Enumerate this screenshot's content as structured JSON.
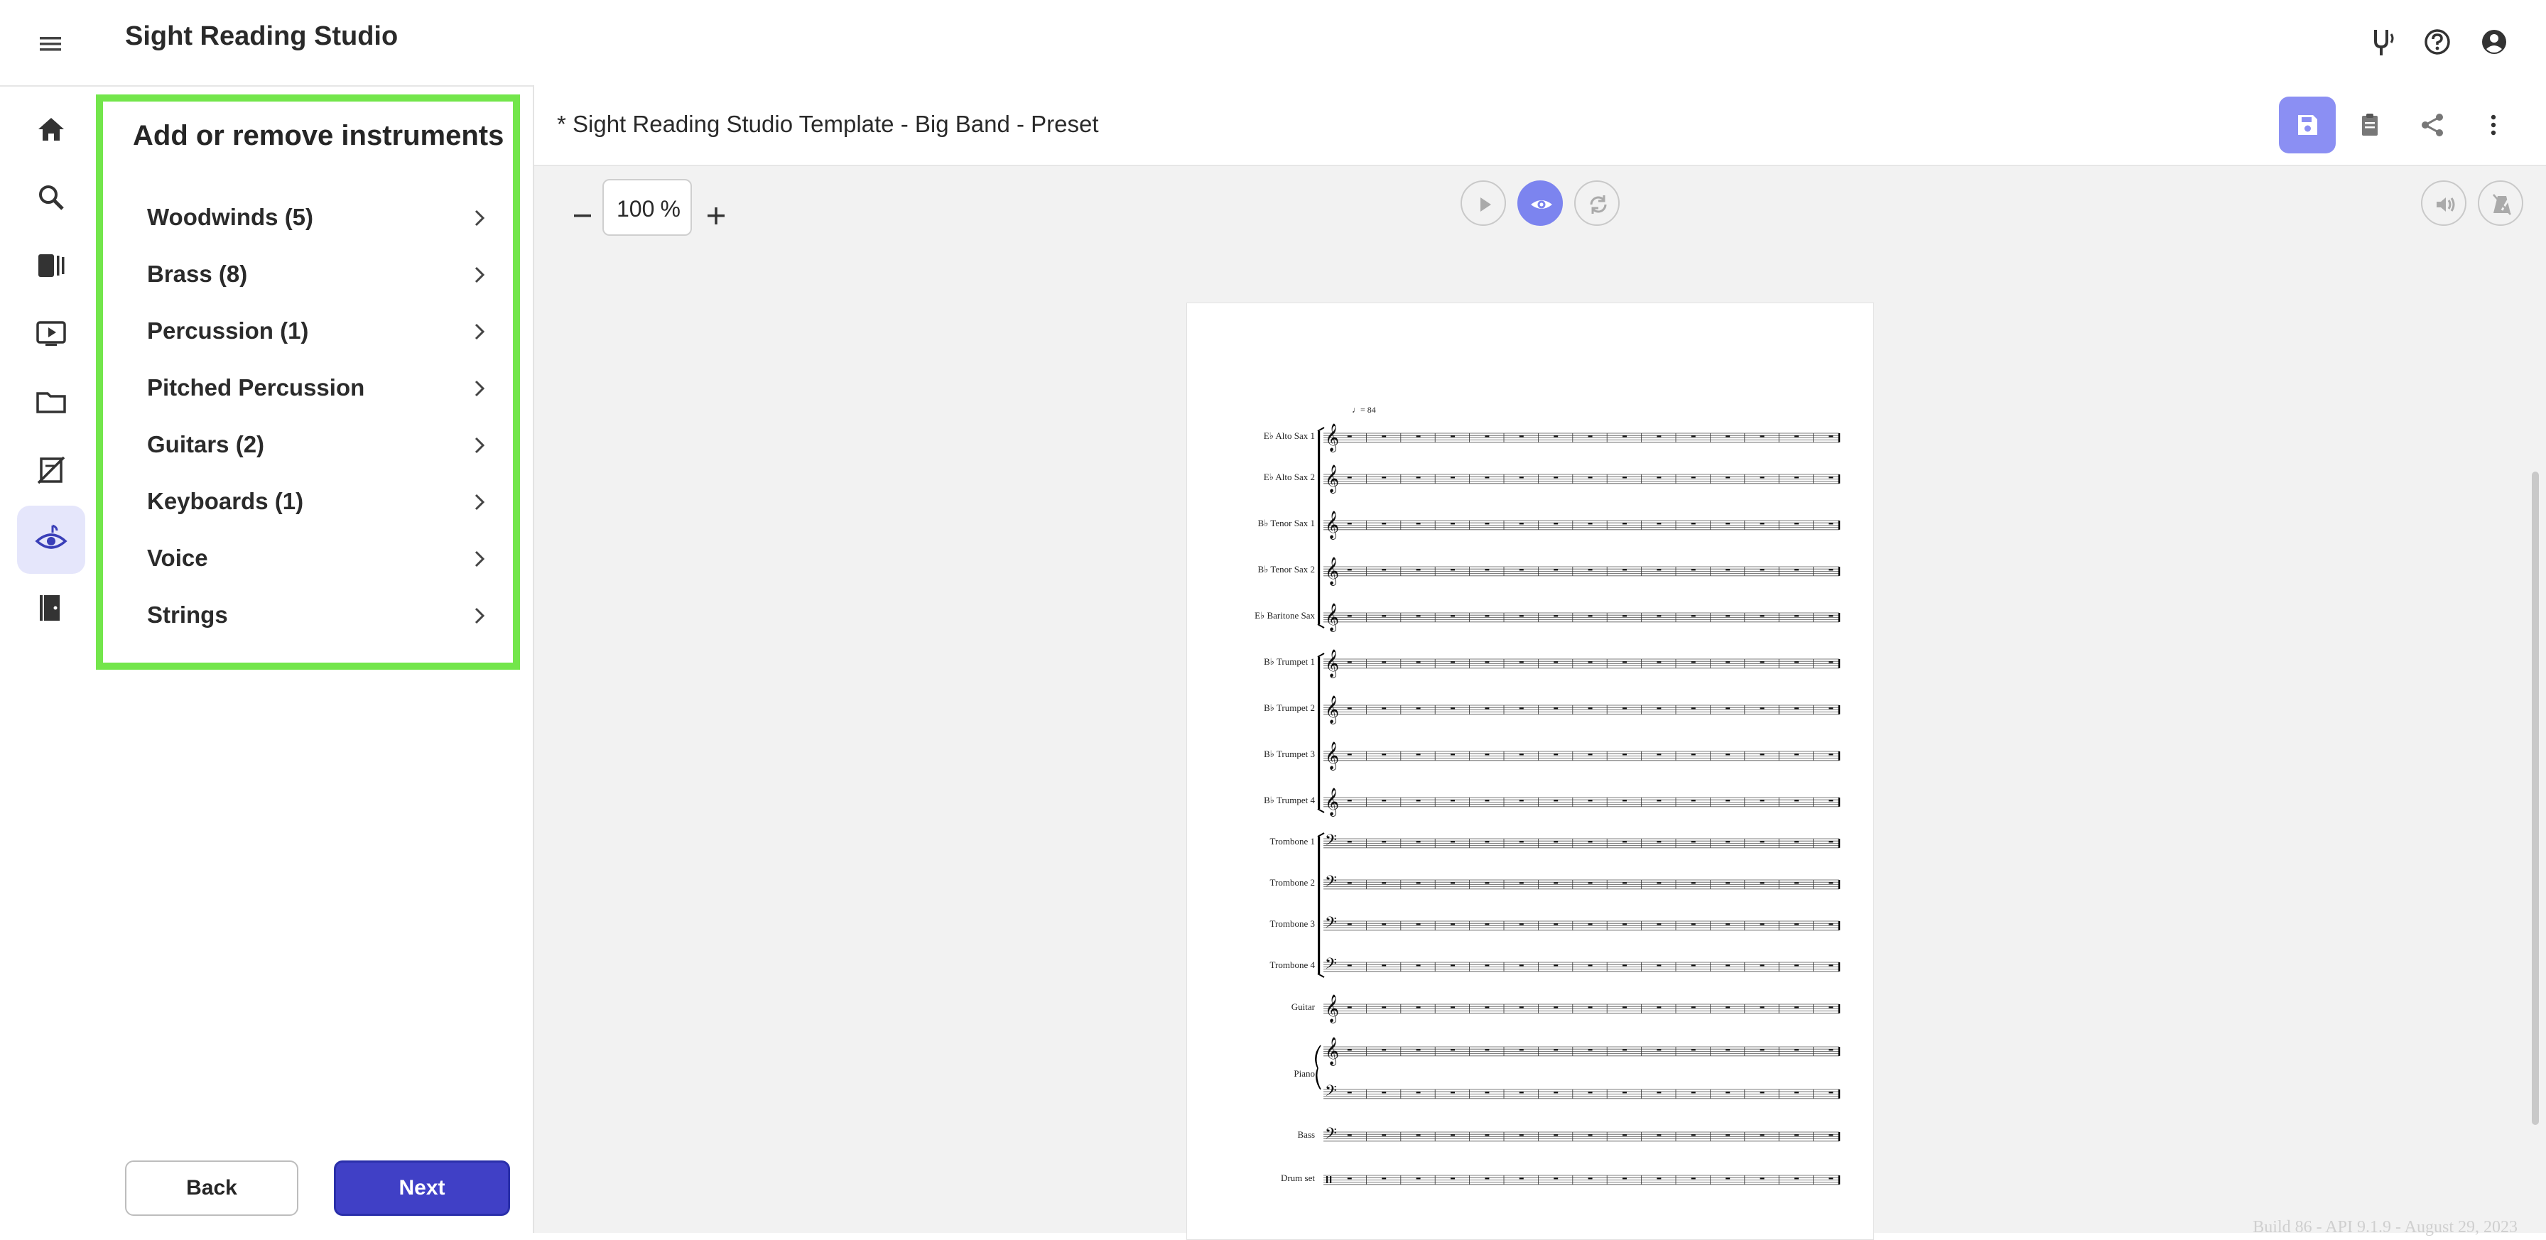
{
  "app": {
    "title": "Sight Reading Studio"
  },
  "top_icons": [
    "tuning-fork-icon",
    "help-icon",
    "account-icon"
  ],
  "rail": [
    "home-icon",
    "search-icon",
    "library-icon",
    "video-icon",
    "folder-icon",
    "assignment-icon",
    "sight-reading-icon",
    "exit-icon"
  ],
  "panel": {
    "title": "Add or remove instruments",
    "items": [
      {
        "label": "Woodwinds (5)"
      },
      {
        "label": "Brass (8)"
      },
      {
        "label": "Percussion (1)"
      },
      {
        "label": "Pitched Percussion"
      },
      {
        "label": "Guitars (2)"
      },
      {
        "label": "Keyboards (1)"
      },
      {
        "label": "Voice"
      },
      {
        "label": "Strings"
      }
    ],
    "back_label": "Back",
    "next_label": "Next"
  },
  "document": {
    "title": "* Sight Reading Studio Template - Big Band - Preset"
  },
  "toolbar": {
    "zoom_value": "100",
    "zoom_unit": "%",
    "minus": "−",
    "plus": "+"
  },
  "score": {
    "tempo": "♩= 84",
    "instruments": [
      "E♭ Alto Sax 1",
      "E♭ Alto Sax 2",
      "B♭ Tenor Sax 1",
      "B♭ Tenor Sax 2",
      "E♭ Baritone Sax",
      "B♭ Trumpet 1",
      "B♭ Trumpet 2",
      "B♭ Trumpet 3",
      "B♭ Trumpet 4",
      "Trombone 1",
      "Trombone 2",
      "Trombone 3",
      "Trombone 4",
      "Guitar",
      "Piano",
      "Bass",
      "Drum set"
    ]
  },
  "footer": {
    "build": "Build 86 - API 9.1.9 - August 29, 2023"
  },
  "colors": {
    "accent": "#4040c6",
    "highlight": "#73e64b",
    "active_rail": "#e5e6fb",
    "eye_toggle": "#7c84ef",
    "save_button": "#8b8ff3"
  }
}
